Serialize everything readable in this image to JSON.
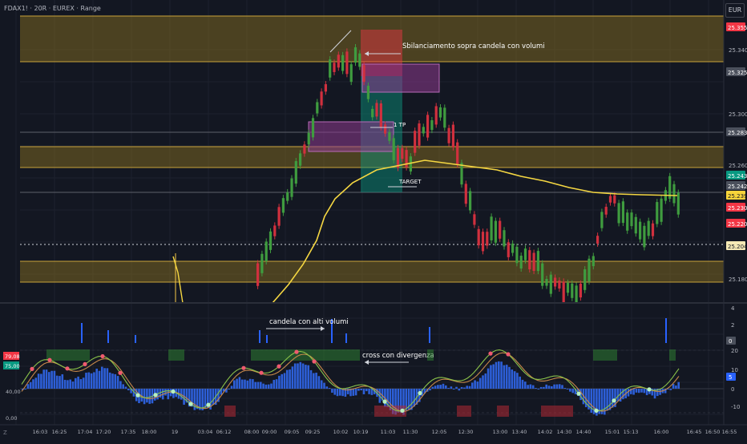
{
  "header": {
    "title": "FDAX1! · 20R · EUREX · Range",
    "currency": "EUR",
    "corner_label": "Z"
  },
  "annotations": {
    "imbalance": "Sbilanciamento sopra candela con volumi",
    "tp": "1 TP",
    "target": "TARGET",
    "high_volume": "candela con alti volumi",
    "cross": "cross con divergenza"
  },
  "price_axis": {
    "ticks": [
      "25.340",
      "25.300",
      "25.260",
      "25.180"
    ],
    "badges": [
      {
        "label": "25.355",
        "color": "#f23645"
      },
      {
        "label": "25.325",
        "color": "#4b505c"
      },
      {
        "label": "25.283",
        "color": "#4b505c"
      },
      {
        "label": "25.243",
        "color": "#089981"
      },
      {
        "label": "25.242",
        "color": "#4b505c"
      },
      {
        "label": "25.239",
        "color": "#f7d43a"
      },
      {
        "label": "25.230",
        "color": "#f23645"
      },
      {
        "label": "25.220",
        "color": "#f23645"
      },
      {
        "label": "25.204",
        "color": "#f5e9b5"
      }
    ]
  },
  "osc_axis": {
    "right_ticks": [
      "4",
      "2",
      "0",
      "20",
      "10",
      "0",
      "-10"
    ],
    "right_badges": [
      {
        "label": "0",
        "color": "#4b505c"
      },
      {
        "label": "5",
        "color": "#2962ff"
      }
    ],
    "left_ticks": [
      "40,00",
      "0,00"
    ],
    "left_badges": [
      {
        "label": "79,08",
        "color": "#f23645"
      },
      {
        "label": "75,00",
        "color": "#089981"
      }
    ]
  },
  "time_axis": [
    "16:03",
    "16:25",
    "17:04",
    "17:20",
    "17:35",
    "18:00",
    "19",
    "03:04",
    "06:12",
    "08:00",
    "09:00",
    "09:05",
    "09:25",
    "10:02",
    "10:19",
    "11:03",
    "11:30",
    "12:05",
    "12:30",
    "13:00",
    "13:40",
    "14:02",
    "14:30",
    "14:40",
    "15:01",
    "15:13",
    "16:00",
    "16:45",
    "16:50",
    "16:55"
  ]
}
